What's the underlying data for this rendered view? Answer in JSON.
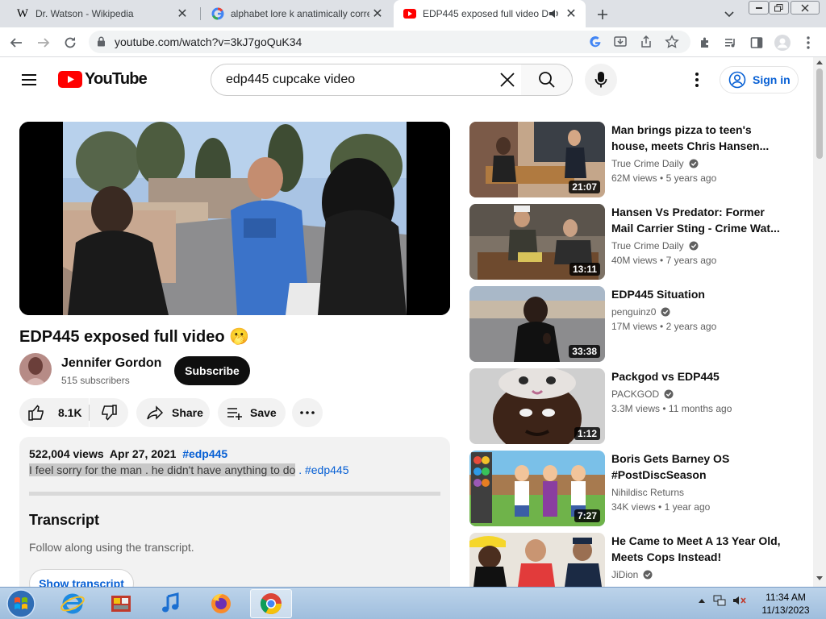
{
  "browser": {
    "tabs": [
      {
        "title": "Dr. Watson - Wikipedia",
        "favicon": "wikipedia-icon"
      },
      {
        "title": "alphabet lore k anatimically corre",
        "favicon": "google-icon"
      },
      {
        "title": "EDP445 exposed full video D",
        "favicon": "youtube-icon",
        "active": true,
        "audio": true
      }
    ],
    "url": "youtube.com/watch?v=3kJ7goQuK34"
  },
  "youtube": {
    "logo_text": "YouTube",
    "search_value": "edp445 cupcake video",
    "signin_label": "Sign in",
    "accent": "#ff0000",
    "link_color": "#065fd4"
  },
  "video": {
    "title": "EDP445 exposed full video 🫢",
    "channel": "Jennifer Gordon",
    "subscribers": "515 subscribers",
    "subscribe_label": "Subscribe",
    "likes": "8.1K",
    "share_label": "Share",
    "save_label": "Save",
    "views": "522,004 views",
    "date": "Apr 27, 2021",
    "hashtag": "#edp445",
    "description": "I feel sorry for the man . he didn't have anything to do",
    "description_tag": ". #edp445",
    "transcript_heading": "Transcript",
    "transcript_text": "Follow along using the transcript.",
    "show_transcript_label": "Show transcript"
  },
  "recommendations": [
    {
      "title": "Man brings pizza to teen's house, meets Chris Hansen...",
      "channel": "True Crime Daily",
      "views": "62M views",
      "age": "5 years ago",
      "duration": "21:07",
      "verified": true
    },
    {
      "title": "Hansen Vs Predator: Former Mail Carrier Sting - Crime Wat...",
      "channel": "True Crime Daily",
      "views": "40M views",
      "age": "7 years ago",
      "duration": "13:11",
      "verified": true
    },
    {
      "title": "EDP445 Situation",
      "channel": "penguinz0",
      "views": "17M views",
      "age": "2 years ago",
      "duration": "33:38",
      "verified": true
    },
    {
      "title": "Packgod vs EDP445",
      "channel": "PACKGOD",
      "views": "3.3M views",
      "age": "11 months ago",
      "duration": "1:12",
      "verified": true
    },
    {
      "title": "Boris Gets Barney OS #PostDiscSeason",
      "channel": "Nihildisc Returns",
      "views": "34K views",
      "age": "1 year ago",
      "duration": "7:27",
      "verified": false
    },
    {
      "title": "He Came to Meet A 13 Year Old, Meets Cops Instead!",
      "channel": "JiDion",
      "views": "",
      "age": "",
      "duration": "",
      "verified": true
    }
  ],
  "taskbar": {
    "apps": [
      "start-orb",
      "internet-explorer",
      "file-manager",
      "itunes",
      "firefox",
      "chrome"
    ],
    "time": "11:34 AM",
    "date": "11/13/2023"
  }
}
